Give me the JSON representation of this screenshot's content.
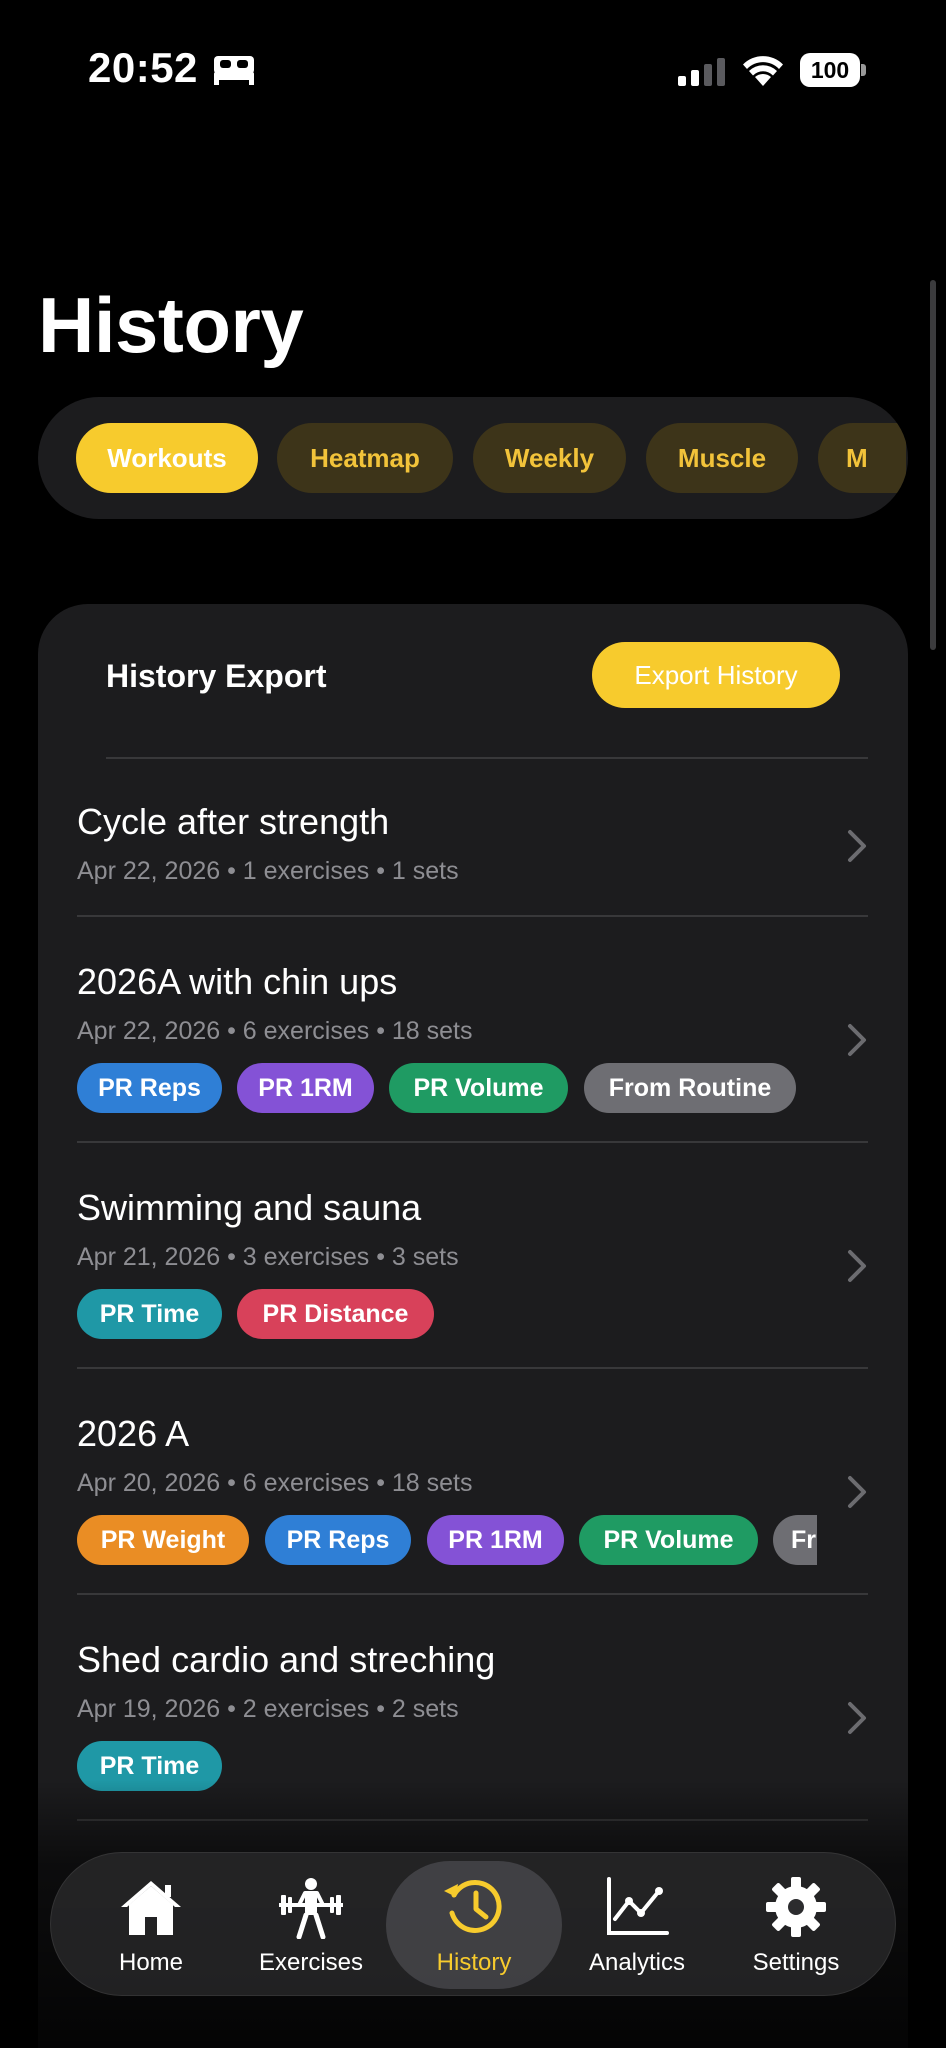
{
  "status_bar": {
    "time": "20:52",
    "battery": "100"
  },
  "page": {
    "title": "History"
  },
  "segments": [
    {
      "label": "Workouts",
      "active": true
    },
    {
      "label": "Heatmap",
      "active": false
    },
    {
      "label": "Weekly",
      "active": false
    },
    {
      "label": "Muscle",
      "active": false
    },
    {
      "label": "M",
      "active": false
    }
  ],
  "export": {
    "title": "History Export",
    "button_label": "Export History"
  },
  "workouts": [
    {
      "title": "Cycle after strength",
      "meta": "Apr 22, 2026 • 1 exercises • 1 sets",
      "badges": []
    },
    {
      "title": "2026A with chin ups",
      "meta": "Apr 22, 2026 • 6 exercises • 18 sets",
      "badges": [
        "PR Reps",
        "PR 1RM",
        "PR Volume",
        "From Routine"
      ]
    },
    {
      "title": "Swimming and sauna",
      "meta": "Apr 21, 2026 • 3 exercises • 3 sets",
      "badges": [
        "PR Time",
        "PR Distance"
      ]
    },
    {
      "title": "2026 A",
      "meta": "Apr 20, 2026 • 6 exercises • 18 sets",
      "badges": [
        "PR Weight",
        "PR Reps",
        "PR 1RM",
        "PR Volume",
        "Fr"
      ]
    },
    {
      "title": "Shed cardio and streching",
      "meta": "Apr 19, 2026 • 2 exercises • 2 sets",
      "badges": [
        "PR Time"
      ]
    }
  ],
  "tab_bar": {
    "items": [
      {
        "label": "Home",
        "icon": "house-icon"
      },
      {
        "label": "Exercises",
        "icon": "weightlifter-icon"
      },
      {
        "label": "History",
        "icon": "clock-history-icon",
        "active": true
      },
      {
        "label": "Analytics",
        "icon": "chart-line-icon"
      },
      {
        "label": "Settings",
        "icon": "gear-icon"
      }
    ]
  },
  "colors": {
    "accent": "#f7cb2d",
    "background": "#000000",
    "card": "#1c1c1e",
    "badge_blue": "#2f7fd6",
    "badge_purple": "#8452d6",
    "badge_green": "#1f9b63",
    "badge_gray": "#6e6e73",
    "badge_teal": "#1f98a6",
    "badge_red": "#d8415a",
    "badge_orange": "#ea8d24"
  }
}
